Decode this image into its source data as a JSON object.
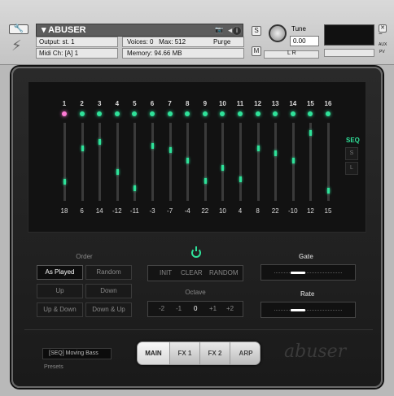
{
  "header": {
    "title": "ABUSER",
    "output_label": "Output:",
    "output_value": "st. 1",
    "midi_label": "Midi Ch:",
    "midi_value": "[A]  1",
    "voices_label": "Voices:",
    "voices_value": "0",
    "max_label": "Max:",
    "max_value": "512",
    "memory_label": "Memory:",
    "memory_value": "94.66 MB",
    "purge_label": "Purge",
    "tune_label": "Tune",
    "tune_value": "0.00",
    "s_button": "S",
    "m_button": "M",
    "nav_label": "◂ ▸",
    "lr_label": "L  R",
    "aux_label": "AUX",
    "pv_label": "PV"
  },
  "sequencer": {
    "steps": [
      {
        "n": "1",
        "value": "18",
        "level": 0.22,
        "active": true
      },
      {
        "n": "2",
        "value": "6",
        "level": 0.68
      },
      {
        "n": "3",
        "value": "14",
        "level": 0.78
      },
      {
        "n": "4",
        "value": "-12",
        "level": 0.36
      },
      {
        "n": "5",
        "value": "-11",
        "level": 0.14
      },
      {
        "n": "6",
        "value": "-3",
        "level": 0.72
      },
      {
        "n": "7",
        "value": "-7",
        "level": 0.66
      },
      {
        "n": "8",
        "value": "-4",
        "level": 0.52
      },
      {
        "n": "9",
        "value": "22",
        "level": 0.24
      },
      {
        "n": "10",
        "value": "10",
        "level": 0.42
      },
      {
        "n": "11",
        "value": "4",
        "level": 0.26
      },
      {
        "n": "12",
        "value": "8",
        "level": 0.68
      },
      {
        "n": "13",
        "value": "22",
        "level": 0.62
      },
      {
        "n": "14",
        "value": "-10",
        "level": 0.52
      },
      {
        "n": "15",
        "value": "12",
        "level": 0.9
      },
      {
        "n": "16",
        "value": "15",
        "level": 0.1
      }
    ],
    "seq_label": "SEQ",
    "s_button": "S",
    "l_button": "L"
  },
  "order": {
    "title": "Order",
    "buttons": [
      "As Played",
      "Random",
      "Up",
      "Down",
      "Up & Down",
      "Down & Up"
    ]
  },
  "controls": {
    "init": "INIT",
    "clear": "CLEAR",
    "random": "RANDOM",
    "octave_title": "Octave",
    "octaves": [
      "-2",
      "-1",
      "0",
      "+1",
      "+2"
    ]
  },
  "gate": {
    "title": "Gate",
    "level": 0.3
  },
  "rate": {
    "title": "Rate",
    "level": 0.3
  },
  "footer": {
    "preset_value": "[SEQ] Moving Bass",
    "presets_label": "Presets",
    "tabs": [
      "MAIN",
      "FX 1",
      "FX 2",
      "ARP"
    ],
    "logo": "abuser"
  },
  "colors": {
    "accent": "#2fe29a",
    "active_step": "#ff7bd6"
  }
}
